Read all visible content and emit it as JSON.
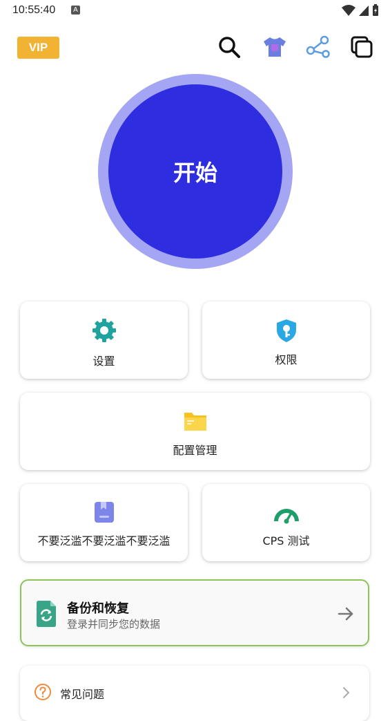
{
  "status": {
    "time": "10:55:40",
    "notif_letter": "A"
  },
  "header": {
    "vip_label": "VIP",
    "icons": [
      "search-icon",
      "theme-shirt-icon",
      "share-icon",
      "copy-windows-icon"
    ]
  },
  "start": {
    "label": "开始"
  },
  "grid": {
    "settings_label": "设置",
    "permissions_label": "权限",
    "config_label": "配置管理",
    "warning_label": "不要泛滥不要泛滥不要泛滥",
    "cps_label": "CPS 测试"
  },
  "backup": {
    "title": "备份和恢复",
    "subtitle": "登录并同步您的数据"
  },
  "faq": {
    "label": "常见问题"
  },
  "colors": {
    "vip": "#f2b233",
    "start_inner": "#2e2ee0",
    "start_ring": "#a5a6f3",
    "settings_icon": "#20a39e",
    "permissions_icon": "#2aa8e6",
    "config_icon": "#f7c11e",
    "warning_icon": "#7d85e8",
    "cps_icon": "#1f9d6b",
    "backup_border": "#8cc45a",
    "backup_icon": "#3aa488",
    "faq_icon": "#f08a3c"
  }
}
